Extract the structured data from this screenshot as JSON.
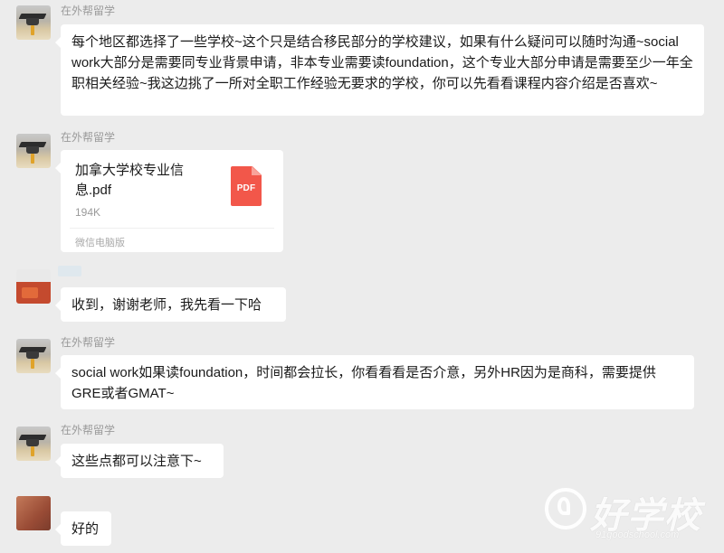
{
  "messages": [
    {
      "sender": "在外帮留学",
      "text": "每个地区都选择了一些学校~这个只是结合移民部分的学校建议，如果有什么疑问可以随时沟通~social work大部分是需要同专业背景申请，非本专业需要读foundation，这个专业大部分申请是需要至少一年全职相关经验~我这边挑了一所对全职工作经验无要求的学校，你可以先看看课程内容介绍是否喜欢~"
    },
    {
      "sender": "在外帮留学",
      "file": {
        "name": "加拿大学校专业信息.pdf",
        "size": "194K",
        "source": "微信电脑版",
        "icon_label": "PDF"
      }
    },
    {
      "sender": "",
      "text": "收到，谢谢老师，我先看一下哈"
    },
    {
      "sender": "在外帮留学",
      "text": "social work如果读foundation，时间都会拉长，你看看看是否介意，另外HR因为是商科，需要提供GRE或者GMAT~"
    },
    {
      "sender": "在外帮留学",
      "text": "这些点都可以注意下~"
    },
    {
      "sender": "",
      "text": "好的"
    }
  ],
  "watermark": {
    "text": "好学校",
    "url": "91goodschool.com"
  },
  "colors": {
    "background": "#ececec",
    "bubble": "#ffffff",
    "pdf_icon": "#f2574a",
    "sender_name": "#9a9a9a"
  }
}
